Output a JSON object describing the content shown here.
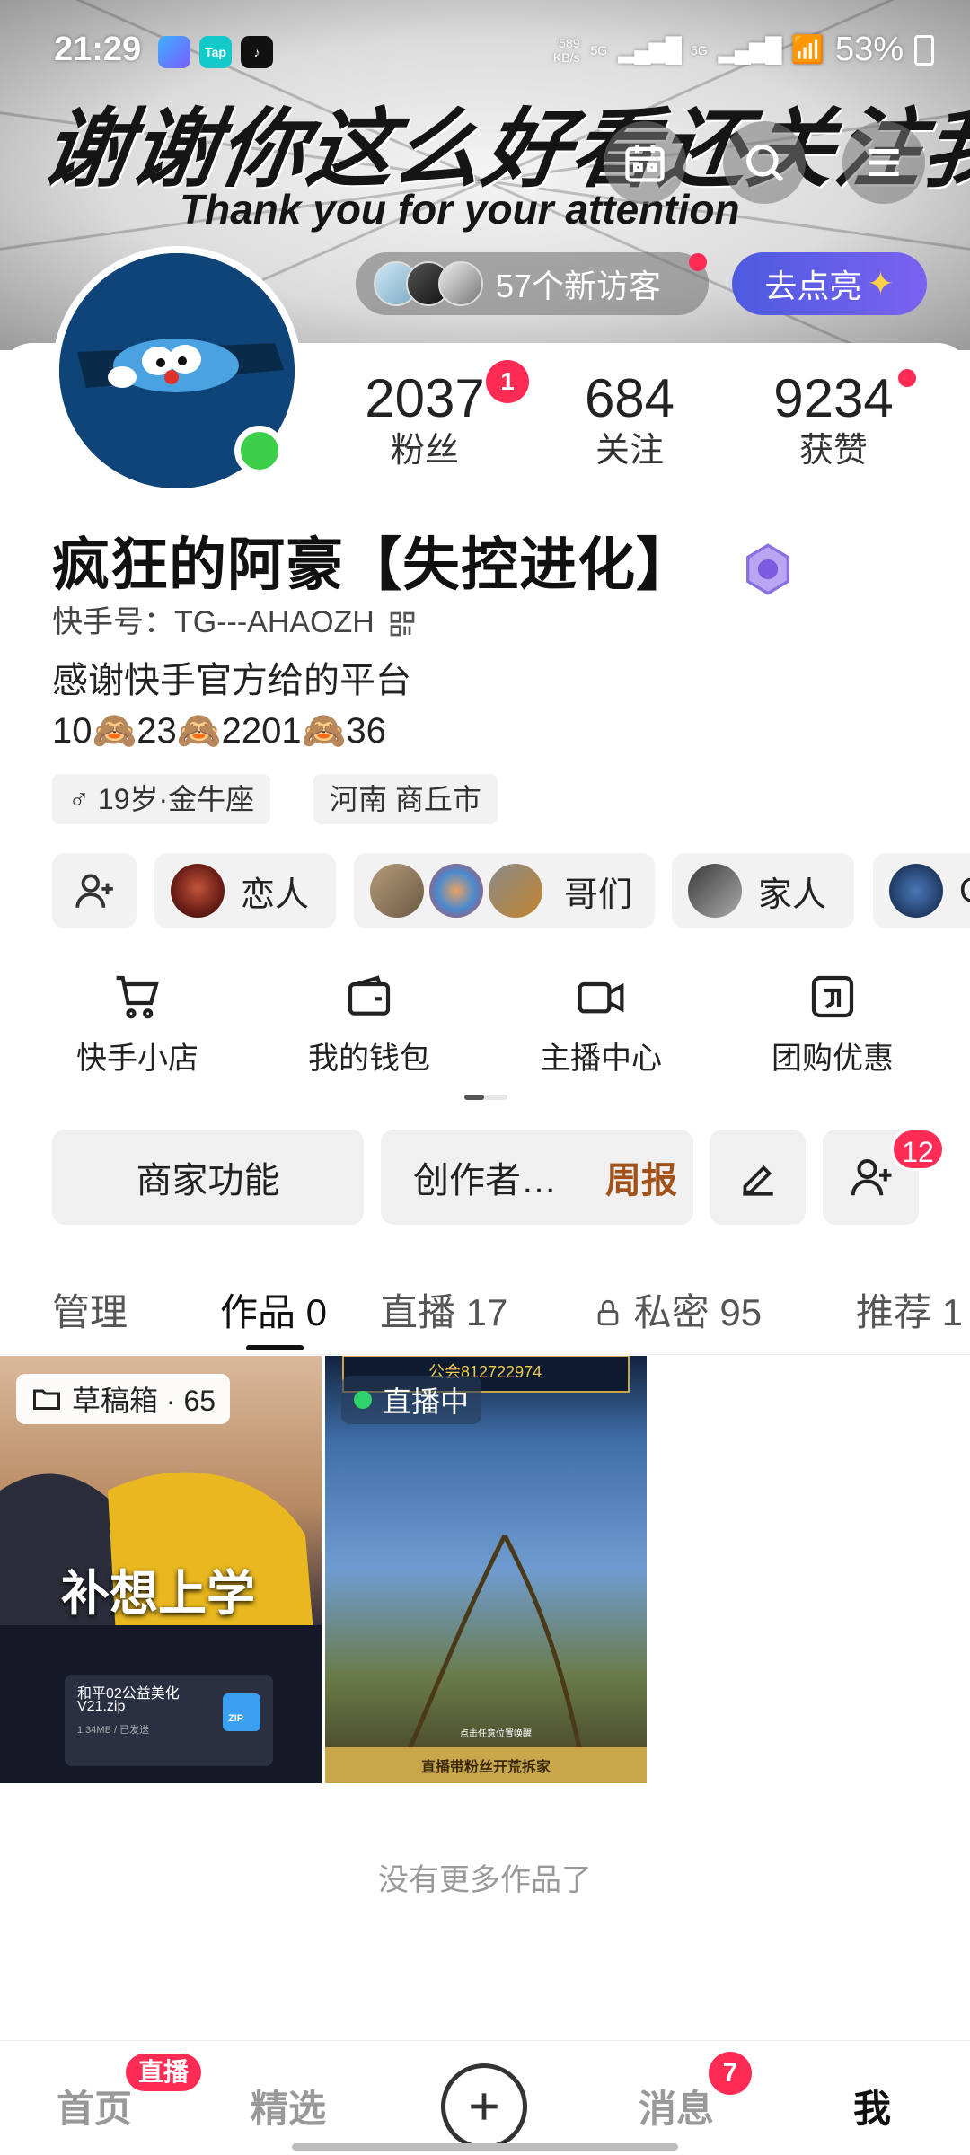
{
  "status_bar": {
    "time": "21:29",
    "apps": [
      "Tap"
    ],
    "net_speed": [
      "589",
      "KB/s"
    ],
    "signal": [
      "5G",
      "5G"
    ],
    "battery": "53%"
  },
  "banner": {
    "title_cn": "谢谢你这么好看还关注我",
    "title_en": "Thank you for your attention"
  },
  "top_buttons": [
    "calendar-icon",
    "search-icon",
    "menu-icon"
  ],
  "visitors": {
    "text": "57个新访客"
  },
  "light_button": {
    "label": "去点亮",
    "icon": "sparkle-icon"
  },
  "stats": [
    {
      "value": "2037",
      "label": "粉丝",
      "badge": "1"
    },
    {
      "value": "684",
      "label": "关注"
    },
    {
      "value": "9234",
      "label": "获赞"
    }
  ],
  "profile": {
    "nickname": "疯狂的阿豪【失控进化】",
    "kuaishou_id": "快手号：TG---AHAOZH",
    "bio_line1": "感谢快手官方给的平台",
    "bio_line2": "10🙈23🙈2201🙈36",
    "tags": [
      "♂ 19岁·金牛座",
      "河南 商丘市"
    ]
  },
  "groups": [
    "恋人",
    "哥们",
    "家人",
    "C"
  ],
  "services": [
    {
      "label": "快手小店",
      "icon": "cart-icon"
    },
    {
      "label": "我的钱包",
      "icon": "wallet-icon"
    },
    {
      "label": "主播中心",
      "icon": "camera-icon"
    },
    {
      "label": "团购优惠",
      "icon": "coupon-icon"
    }
  ],
  "actions": {
    "merchant": "商家功能",
    "creator": "创作者…",
    "weekly": "周报",
    "friend_badge": "12"
  },
  "tabs": [
    {
      "label": "管理"
    },
    {
      "label": "作品 0"
    },
    {
      "label": "直播 17"
    },
    {
      "label": "私密 95"
    },
    {
      "label": "推荐 1"
    }
  ],
  "tiles": {
    "draft_label": "草稿箱 · 65",
    "draft_caption": "补想上学",
    "file_name": "和平02公益美化",
    "file_name2": "V21.zip",
    "file_meta": "1.34MB / 已发送",
    "file_ext": "ZIP",
    "live_label": "直播中",
    "guild_text": "公会812722974",
    "live_sub": "点击任意位置唤醒",
    "live_banner": "直播带粉丝开荒拆家"
  },
  "no_more": "没有更多作品了",
  "bottom_nav": {
    "home": "首页",
    "live_badge": "直播",
    "featured": "精选",
    "messages": "消息",
    "messages_badge": "7",
    "me": "我"
  },
  "colors": {
    "accent_red": "#fe2c55",
    "online_green": "#3ccf4a",
    "light_button": "#5b5ce6",
    "weekly_text": "#a0521a"
  }
}
